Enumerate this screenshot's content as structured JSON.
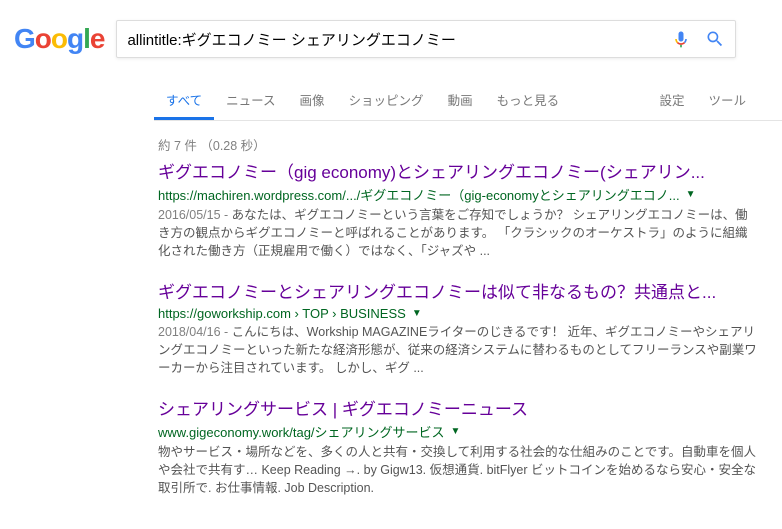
{
  "search": {
    "query": "allintitle:ギグエコノミー シェアリングエコノミー"
  },
  "tabs": {
    "all": "すべて",
    "news": "ニュース",
    "images": "画像",
    "shopping": "ショッピング",
    "videos": "動画",
    "more": "もっと見る",
    "settings": "設定",
    "tools": "ツール"
  },
  "stats": "約 7 件 （0.28 秒）",
  "results": [
    {
      "title": "ギグエコノミー（gig economy)とシェアリングエコノミー(シェアリン...",
      "url": "https://machiren.wordpress.com/.../ギグエコノミー（gig-economyとシェアリングエコノ...",
      "date": "2016/05/15 - ",
      "snippet": "あなたは、ギグエコノミーという言葉をご存知でしょうか？ シェアリングエコノミーは、働き方の観点からギグエコノミーと呼ばれることがあります。 「クラシックのオーケストラ」のように組織化された働き方（正規雇用で働く）ではなく、「ジャズや ..."
    },
    {
      "title": "ギグエコノミーとシェアリングエコノミーは似て非なるもの？共通点と...",
      "url": "https://goworkship.com › TOP › BUSINESS",
      "date": "2018/04/16 - ",
      "snippet": "こんにちは、Workship MAGAZINEライターのじきるです！ 近年、ギグエコノミーやシェアリングエコノミーといった新たな経済形態が、従来の経済システムに替わるものとしてフリーランスや副業ワーカーから注目されています。 しかし、ギグ ..."
    },
    {
      "title": "シェアリングサービス | ギグエコノミーニュース",
      "url": "www.gigeconomy.work/tag/シェアリングサービス",
      "date": "",
      "snippet": "物やサービス・場所などを、多くの人と共有・交換して利用する社会的な仕組みのことです。自動車を個人や会社で共有す… Keep Reading →. by Gigw13. 仮想通貨. bitFlyer ビットコインを始めるなら安心・安全な取引所で. お仕事情報. Job Description."
    }
  ]
}
